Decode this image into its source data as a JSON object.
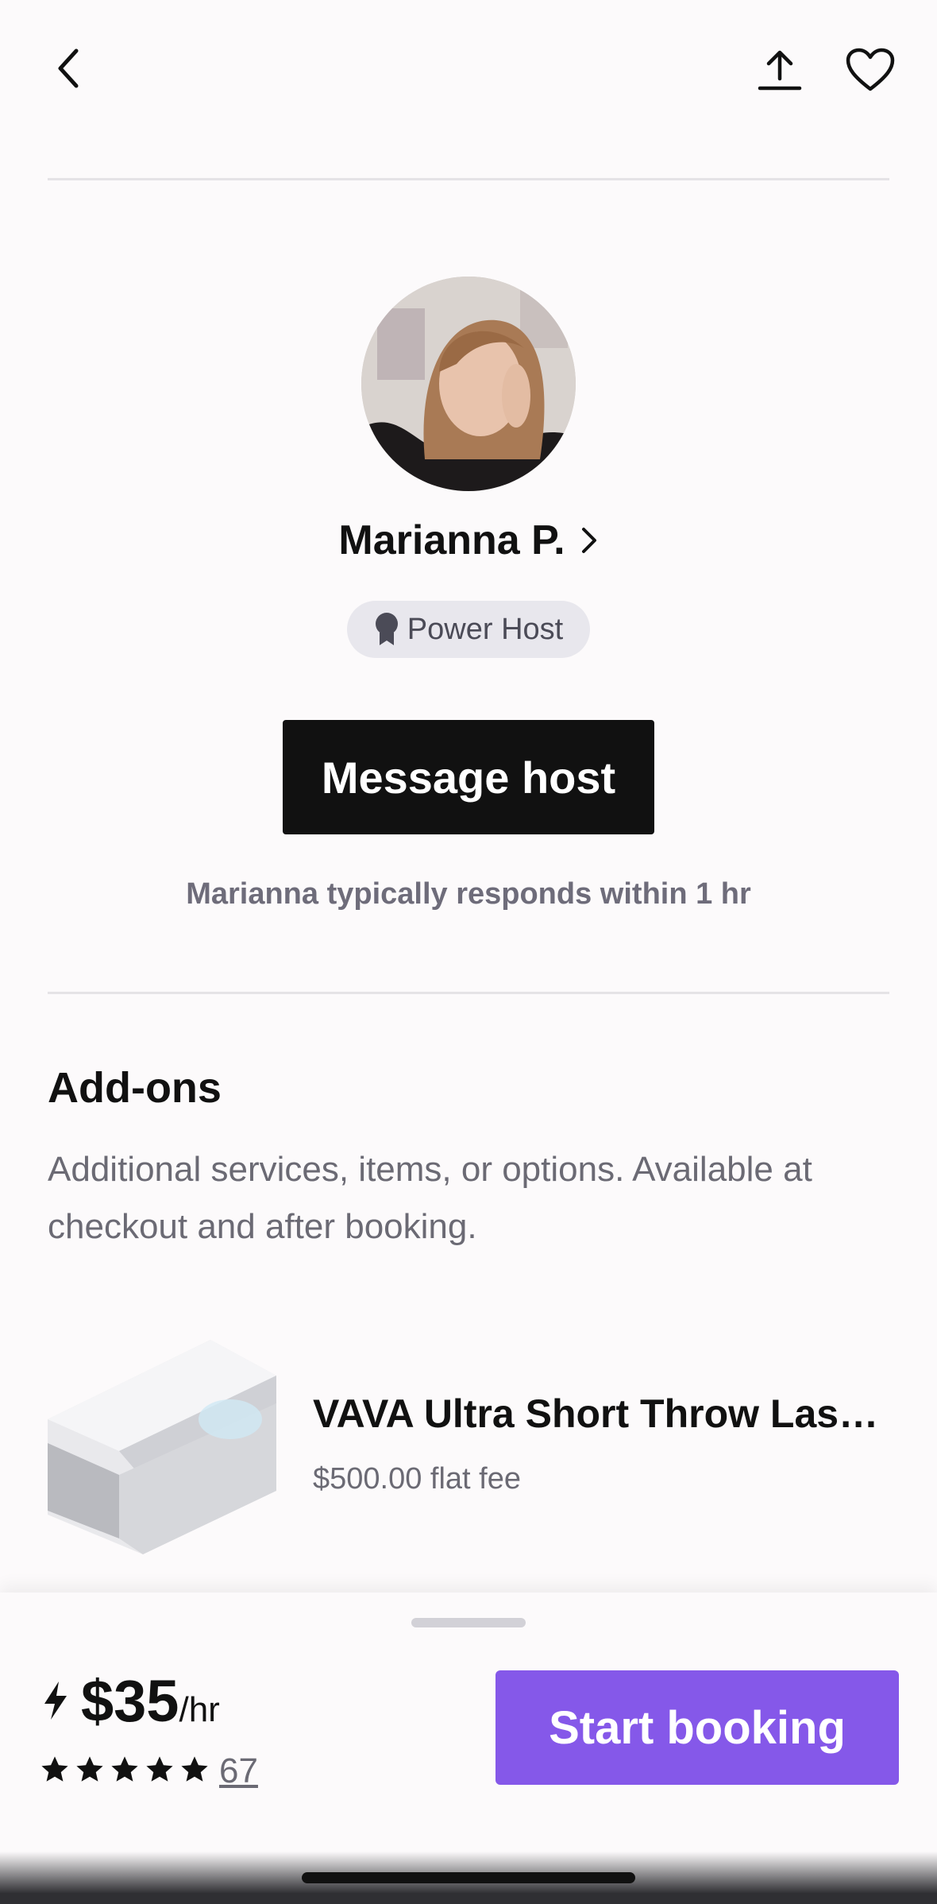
{
  "header": {
    "back_icon": "chevron-left-icon",
    "share_icon": "share-upload-icon",
    "favorite_icon": "heart-outline-icon"
  },
  "host": {
    "name": "Marianna P.",
    "badge_label": "Power Host",
    "badge_icon": "award-ribbon-icon",
    "message_button": "Message host",
    "response_text": "Marianna typically responds within 1 hr"
  },
  "addons": {
    "title": "Add-ons",
    "description": "Additional services, items, or options. Available at checkout and after booking.",
    "items": [
      {
        "name": "VAVA Ultra Short Throw Lase...",
        "price": "$500.00 flat fee"
      }
    ]
  },
  "booking": {
    "instant_icon": "lightning-bolt-icon",
    "price": "$35",
    "unit": "/hr",
    "rating_stars": 5,
    "review_count": "67",
    "cta": "Start booking"
  },
  "colors": {
    "accent": "#8558e9",
    "primary_button": "#111111",
    "badge_bg": "#e8e7ed",
    "muted_text": "#6b6a74"
  }
}
